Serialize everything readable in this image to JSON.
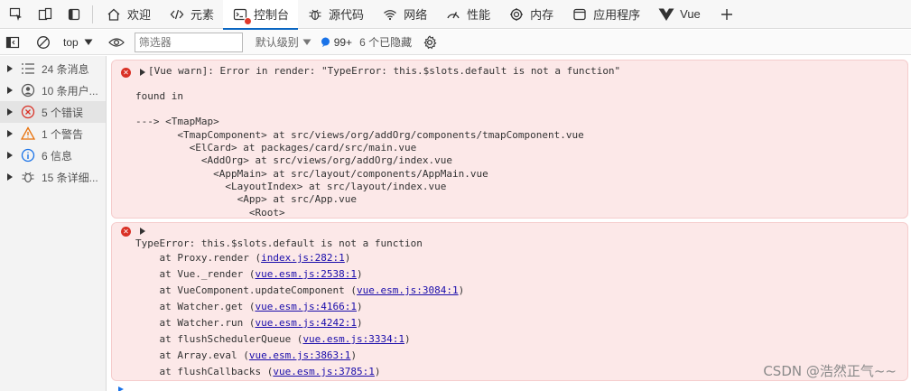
{
  "tabs": [
    {
      "label": "欢迎",
      "icon": "home-icon"
    },
    {
      "label": "元素",
      "icon": "code-icon"
    },
    {
      "label": "控制台",
      "icon": "console-icon",
      "active": true
    },
    {
      "label": "源代码",
      "icon": "bug-icon"
    },
    {
      "label": "网络",
      "icon": "wifi-icon"
    },
    {
      "label": "性能",
      "icon": "performance-icon"
    },
    {
      "label": "内存",
      "icon": "memory-icon"
    },
    {
      "label": "应用程序",
      "icon": "application-icon"
    },
    {
      "label": "Vue",
      "icon": "vue-icon"
    }
  ],
  "toolbar": {
    "context": "top",
    "filter_placeholder": "筛选器",
    "level": "默认级别",
    "issues_count": "99+",
    "hidden": "6 个已隐藏"
  },
  "sidebar": {
    "items": [
      {
        "label": "24 条消息",
        "icon": "list-icon"
      },
      {
        "label": "10 条用户...",
        "icon": "user-icon"
      },
      {
        "label": "5 个错误",
        "icon": "error-icon"
      },
      {
        "label": "1 个警告",
        "icon": "warning-icon"
      },
      {
        "label": "6 信息",
        "icon": "info-icon"
      },
      {
        "label": "15 条详细...",
        "icon": "verbose-icon"
      }
    ]
  },
  "messages": {
    "m1": {
      "head": "[Vue warn]: Error in render: \"TypeError: this.$slots.default is not a function\"",
      "found": "found in",
      "trace": [
        "---> <TmapMap>",
        "       <TmapComponent> at src/views/org/addOrg/components/tmapComponent.vue",
        "         <ElCard> at packages/card/src/main.vue",
        "           <AddOrg> at src/views/org/addOrg/index.vue",
        "             <AppMain> at src/layout/components/AppMain.vue",
        "               <LayoutIndex> at src/layout/index.vue",
        "                 <App> at src/App.vue",
        "                   <Root>"
      ]
    },
    "m2": {
      "head": "TypeError: this.$slots.default is not a function",
      "frames": [
        {
          "pre": "    at Proxy.render (",
          "link": "index.js:282:1",
          "post": ")"
        },
        {
          "pre": "    at Vue._render (",
          "link": "vue.esm.js:2538:1",
          "post": ")"
        },
        {
          "pre": "    at VueComponent.updateComponent (",
          "link": "vue.esm.js:3084:1",
          "post": ")"
        },
        {
          "pre": "    at Watcher.get (",
          "link": "vue.esm.js:4166:1",
          "post": ")"
        },
        {
          "pre": "    at Watcher.run (",
          "link": "vue.esm.js:4242:1",
          "post": ")"
        },
        {
          "pre": "    at flushSchedulerQueue (",
          "link": "vue.esm.js:3334:1",
          "post": ")"
        },
        {
          "pre": "    at Array.eval (",
          "link": "vue.esm.js:3863:1",
          "post": ")"
        },
        {
          "pre": "    at flushCallbacks (",
          "link": "vue.esm.js:3785:1",
          "post": ")"
        }
      ]
    }
  },
  "watermark": "CSDN @浩然正气~~"
}
